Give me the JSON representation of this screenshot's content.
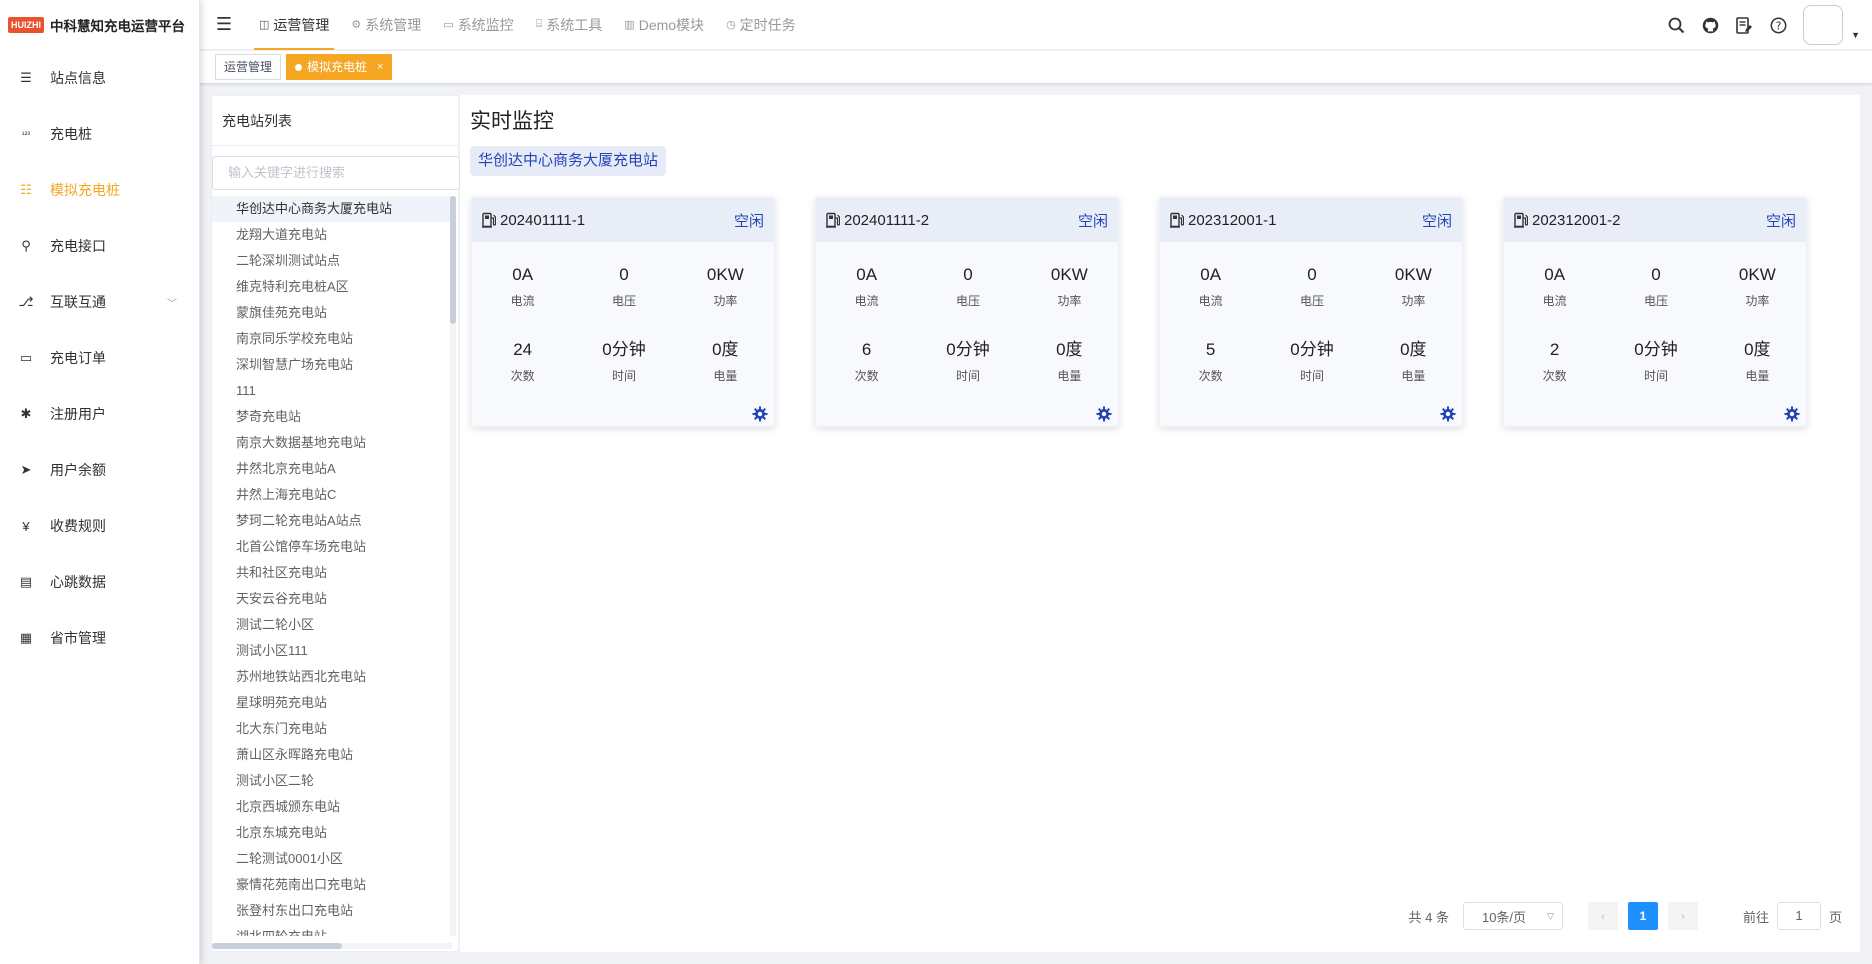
{
  "app": {
    "logo_badge": "HUIZHI",
    "title": "中科慧知充电运营平台"
  },
  "sidebar": {
    "items": [
      {
        "label": "站点信息",
        "icon": "list-icon",
        "active": false
      },
      {
        "label": "充电桩",
        "icon": "number-icon",
        "active": false
      },
      {
        "label": "模拟充电桩",
        "icon": "tree-list-icon",
        "active": true
      },
      {
        "label": "充电接口",
        "icon": "plug-icon",
        "active": false
      },
      {
        "label": "互联互通",
        "icon": "link-icon",
        "active": false,
        "has_children": true
      },
      {
        "label": "充电订单",
        "icon": "monitor-icon",
        "active": false
      },
      {
        "label": "注册用户",
        "icon": "bug-icon",
        "active": false
      },
      {
        "label": "用户余额",
        "icon": "send-icon",
        "active": false
      },
      {
        "label": "收费规则",
        "icon": "yen-icon",
        "active": false
      },
      {
        "label": "心跳数据",
        "icon": "chart-icon",
        "active": false
      },
      {
        "label": "省市管理",
        "icon": "document-icon",
        "active": false
      }
    ]
  },
  "topnav": {
    "items": [
      {
        "label": "运营管理",
        "active": true
      },
      {
        "label": "系统管理",
        "active": false
      },
      {
        "label": "系统监控",
        "active": false
      },
      {
        "label": "系统工具",
        "active": false
      },
      {
        "label": "Demo模块",
        "active": false
      },
      {
        "label": "定时任务",
        "active": false
      }
    ]
  },
  "tags": [
    {
      "label": "运营管理",
      "active": false
    },
    {
      "label": "模拟充电桩",
      "active": true,
      "close": "×"
    }
  ],
  "station_panel": {
    "title": "充电站列表",
    "search_placeholder": "输入关键字进行搜索",
    "stations": [
      "华创达中心商务大厦充电站",
      "龙翔大道充电站",
      "二轮深圳测试站点",
      "维克特利充电桩A区",
      "蒙旗佳苑充电站",
      "南京同乐学校充电站",
      "深圳智慧广场充电站",
      "111",
      "梦奇充电站",
      "南京大数据基地充电站",
      "井然北京充电站A",
      "井然上海充电站C",
      "梦珂二轮充电站A站点",
      "北首公馆停车场充电站",
      "共和社区充电站",
      "天安云谷充电站",
      "测试二轮小区",
      "测试小区111",
      "苏州地铁站西北充电站",
      "星球明苑充电站",
      "北大东门充电站",
      "萧山区永晖路充电站",
      "测试小区二轮",
      "北京西城颁东电站",
      "北京东城充电站",
      "二轮测试0001小区",
      "豪情花苑南出口充电站",
      "张登村东出口充电站",
      "湖北四轮充电站"
    ]
  },
  "main": {
    "title": "实时监控",
    "selected_station": "华创达中心商务大厦充电站",
    "cards": [
      {
        "id": "202401111-1",
        "status": "空闲",
        "current": "0A",
        "voltage": "0",
        "power": "0KW",
        "count": "24",
        "time": "0分钟",
        "energy": "0度"
      },
      {
        "id": "202401111-2",
        "status": "空闲",
        "current": "0A",
        "voltage": "0",
        "power": "0KW",
        "count": "6",
        "time": "0分钟",
        "energy": "0度"
      },
      {
        "id": "202312001-1",
        "status": "空闲",
        "current": "0A",
        "voltage": "0",
        "power": "0KW",
        "count": "5",
        "time": "0分钟",
        "energy": "0度"
      },
      {
        "id": "202312001-2",
        "status": "空闲",
        "current": "0A",
        "voltage": "0",
        "power": "0KW",
        "count": "2",
        "time": "0分钟",
        "energy": "0度"
      }
    ],
    "labels": {
      "current": "电流",
      "voltage": "电压",
      "power": "功率",
      "count": "次数",
      "time": "时间",
      "energy": "电量"
    }
  },
  "pagination": {
    "total": "共 4 条",
    "page_size": "10条/页",
    "current_page": "1",
    "goto_prefix": "前往",
    "goto_value": "1",
    "goto_suffix": "页"
  },
  "colors": {
    "accent": "#f5a623",
    "status_blue": "#2444b8",
    "page_active": "#1e90ff"
  }
}
